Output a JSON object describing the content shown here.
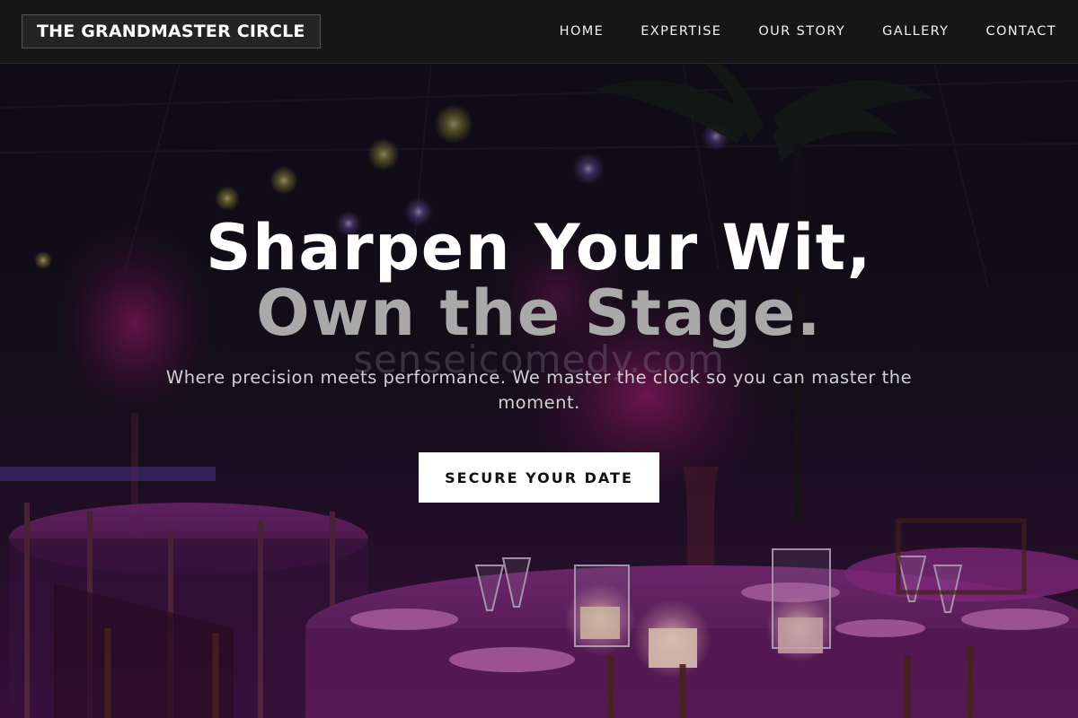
{
  "brand": {
    "name": "THE GRANDMASTER CIRCLE"
  },
  "nav": {
    "items": [
      {
        "label": "HOME"
      },
      {
        "label": "EXPERTISE"
      },
      {
        "label": "OUR STORY"
      },
      {
        "label": "GALLERY"
      },
      {
        "label": "CONTACT"
      }
    ]
  },
  "hero": {
    "headline_line1": "Sharpen Your Wit,",
    "headline_line2": "Own the Stage.",
    "tagline": "Where precision meets performance. We master the clock so you can master the moment.",
    "cta_label": "SECURE YOUR DATE",
    "watermark": "senseicomedy.com"
  },
  "colors": {
    "nav_background": "#161616",
    "headline_primary": "#ffffff",
    "headline_secondary": "#a9a9a9",
    "cta_background": "#ffffff",
    "scene_accent": "#8e1a78"
  }
}
